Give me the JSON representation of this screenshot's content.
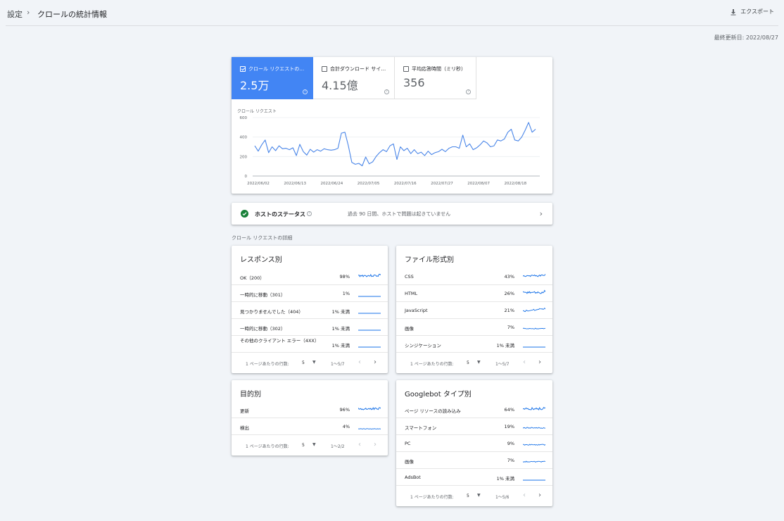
{
  "breadcrumb": {
    "parent": "設定",
    "separator": "›",
    "current": "クロールの統計情報"
  },
  "export_label": "エクスポート",
  "last_updated": "最終更新日: 2022/08/27",
  "metrics": [
    {
      "label": "クロール リクエストの…",
      "value": "2.5万",
      "active": true
    },
    {
      "label": "合計ダウンロード サイ…",
      "value": "4.15億",
      "active": false
    },
    {
      "label": "平均応答時間（ミリ秒）",
      "value": "356",
      "active": false
    }
  ],
  "help_glyph": "?",
  "chart_data": {
    "type": "line",
    "title": "クロール リクエスト",
    "ylim": [
      0,
      600
    ],
    "y_ticks": [
      "0",
      "200",
      "400",
      "600"
    ],
    "x_ticks": [
      "2022/06/02",
      "2022/06/13",
      "2022/06/24",
      "2022/07/05",
      "2022/07/16",
      "2022/07/27",
      "2022/08/07",
      "2022/08/18"
    ],
    "x_range": [
      "2022/06/02",
      "2022/08/27"
    ],
    "series": [
      {
        "values": [
          310,
          255,
          320,
          370,
          240,
          300,
          260,
          310,
          280,
          285,
          270,
          290,
          210,
          325,
          250,
          215,
          275,
          245,
          270,
          255,
          280,
          270,
          265,
          270,
          285,
          440,
          450,
          310,
          140,
          120,
          130,
          105,
          195,
          125,
          145,
          200,
          240,
          270,
          250,
          310,
          330,
          170,
          300,
          260,
          285,
          230,
          270,
          230,
          245,
          210,
          255,
          220,
          240,
          250,
          275,
          250,
          285,
          300,
          300,
          285,
          420,
          300,
          330,
          270,
          290,
          320,
          360,
          340,
          300,
          310,
          370,
          360,
          380,
          450,
          480,
          370,
          360,
          400,
          470,
          550,
          450,
          480
        ]
      }
    ],
    "color": "#4a86e8",
    "grid": true
  },
  "host_status": {
    "title": "ホストのステータス",
    "message": "過去 90 日間、ホストで問題は起きていません",
    "chevron": "›"
  },
  "section_label": "クロール リクエストの詳細",
  "pagination": {
    "rows_label": "1 ページあたりの行数:",
    "rows_value": "5",
    "caret": "▼",
    "prev": "‹",
    "next": "›"
  },
  "breakdowns": {
    "response": {
      "title": "レスポンス別",
      "rows": [
        {
          "name": "OK（200）",
          "pct": "98%"
        },
        {
          "name": "一時的に移動（301）",
          "pct": "1%"
        },
        {
          "name": "見つかりませんでした（404）",
          "pct": "1% 未満"
        },
        {
          "name": "一時的に移動（302）",
          "pct": "1% 未満"
        },
        {
          "name": "その他のクライアント エラー（4XX）",
          "pct": "1% 未満"
        }
      ],
      "range": "1～5/7"
    },
    "filetype": {
      "title": "ファイル形式別",
      "rows": [
        {
          "name": "CSS",
          "pct": "43%"
        },
        {
          "name": "HTML",
          "pct": "26%"
        },
        {
          "name": "JavaScript",
          "pct": "21%"
        },
        {
          "name": "画像",
          "pct": "7%"
        },
        {
          "name": "シンジケーション",
          "pct": "1% 未満"
        }
      ],
      "range": "1～5/7"
    },
    "purpose": {
      "title": "目的別",
      "rows": [
        {
          "name": "更新",
          "pct": "96%"
        },
        {
          "name": "検出",
          "pct": "4%"
        }
      ],
      "range": "1～2/2"
    },
    "googlebot": {
      "title": "Googlebot タイプ別",
      "rows": [
        {
          "name": "ページ リソースの読み込み",
          "pct": "64%"
        },
        {
          "name": "スマートフォン",
          "pct": "19%"
        },
        {
          "name": "PC",
          "pct": "9%"
        },
        {
          "name": "画像",
          "pct": "7%"
        },
        {
          "name": "AdsBot",
          "pct": "1% 未満"
        }
      ],
      "range": "1～5/6"
    }
  }
}
